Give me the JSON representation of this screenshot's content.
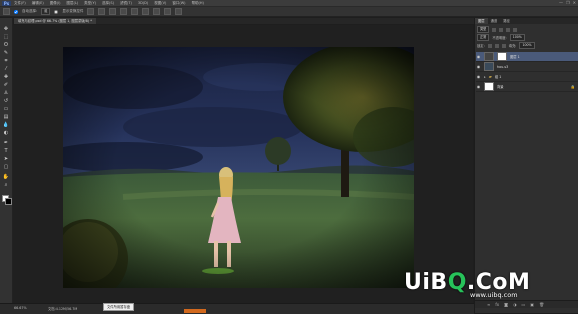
{
  "app": {
    "logo": "Ps"
  },
  "menubar": {
    "items": [
      "文件(F)",
      "编辑(E)",
      "图像(I)",
      "图层(L)",
      "类型(Y)",
      "选择(S)",
      "滤镜(T)",
      "3D(D)",
      "视图(V)",
      "窗口(W)",
      "帮助(H)"
    ],
    "window_controls": [
      "—",
      "❐",
      "✕"
    ]
  },
  "optionsbar": {
    "auto_select_label": "自动选择:",
    "auto_select_value": "组",
    "show_transform_label": "显示变换控件",
    "icons": [
      "move-tool-icon",
      "align-icon",
      "distribute-icon",
      "3d-mode-icon"
    ]
  },
  "document": {
    "tab_title": "填充与纹理.psd @ 66.7% (图层 1, 图层蒙版/8) *"
  },
  "statusbar": {
    "zoom": "66.67%",
    "doc_info": "文档:4.12M/56.7M",
    "tooltip": "文件所用暂存盘"
  },
  "panels": {
    "tabs": [
      "图层",
      "通道",
      "路径"
    ],
    "active_tab": "图层",
    "filter_label": "类型",
    "blend_mode": "正常",
    "opacity_label": "不透明度:",
    "opacity_value": "100%",
    "lock_label": "锁定:",
    "fill_label": "填充:",
    "fill_value": "100%",
    "layers": [
      {
        "name": "图层 1",
        "visible": true,
        "selected": true,
        "has_mask": true
      },
      {
        "name": "hou-s3",
        "visible": true,
        "selected": false,
        "has_mask": false
      },
      {
        "name": "组 1",
        "visible": true,
        "selected": false,
        "has_mask": false,
        "is_group": true
      },
      {
        "name": "背景",
        "visible": true,
        "selected": false,
        "has_mask": false
      }
    ],
    "footer_icons": [
      "link-icon",
      "fx-icon",
      "mask-icon",
      "adjustment-icon",
      "folder-icon",
      "new-layer-icon",
      "trash-icon"
    ]
  },
  "tools": [
    "move",
    "marquee",
    "lasso",
    "quick-select",
    "crop",
    "eyedropper",
    "healing",
    "brush",
    "clone-stamp",
    "history-brush",
    "eraser",
    "gradient",
    "blur",
    "dodge",
    "pen",
    "type",
    "path-select",
    "shape",
    "hand",
    "zoom"
  ],
  "watermark": {
    "text_before": "UiB",
    "text_q": "Q",
    "text_after": ".CoM",
    "url": "www.uibq.com"
  },
  "colors": {
    "foreground": "#ffffff",
    "background": "#000000",
    "selected_layer": "#4a5a7a",
    "accent": "#d2691e"
  }
}
